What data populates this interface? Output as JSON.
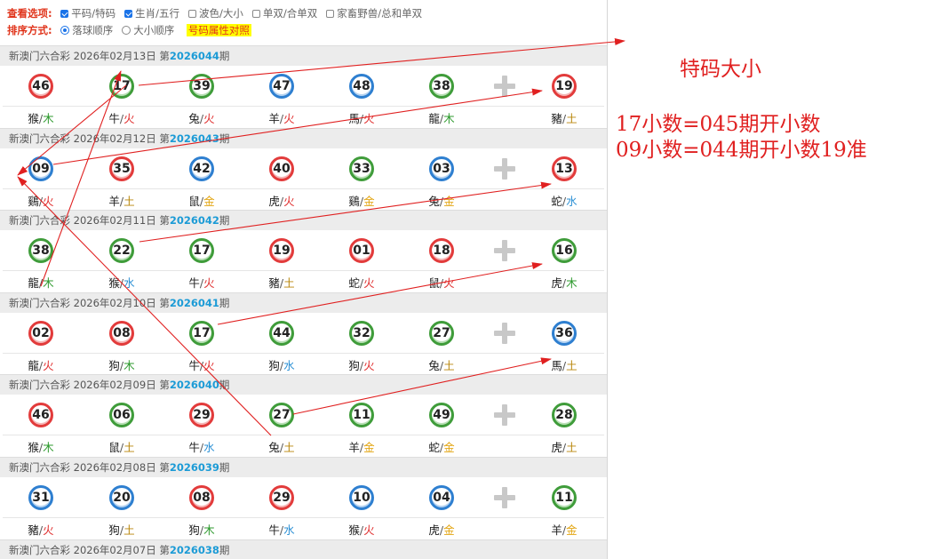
{
  "options": {
    "view_label": "查看选项:",
    "view_items": [
      {
        "label": "平码/特码",
        "checked": true
      },
      {
        "label": "生肖/五行",
        "checked": true
      },
      {
        "label": "波色/大小",
        "checked": false
      },
      {
        "label": "单双/合单双",
        "checked": false
      },
      {
        "label": "家畜野兽/总和单双",
        "checked": false
      }
    ],
    "sort_label": "排序方式:",
    "sort_items": [
      {
        "label": "落球顺序",
        "selected": true
      },
      {
        "label": "大小顺序",
        "selected": false
      }
    ],
    "highlight_link": "号码属性对照"
  },
  "draws": [
    {
      "lottery": "新澳门六合彩",
      "date": "2026年02月13日",
      "issue_prefix": "第",
      "issue": "2026044",
      "issue_suffix": "期",
      "balls": [
        {
          "num": "46",
          "color": "red",
          "zodiac": "猴",
          "element": "木"
        },
        {
          "num": "17",
          "color": "green",
          "zodiac": "牛",
          "element": "火"
        },
        {
          "num": "39",
          "color": "green",
          "zodiac": "兔",
          "element": "火"
        },
        {
          "num": "47",
          "color": "blue",
          "zodiac": "羊",
          "element": "火"
        },
        {
          "num": "48",
          "color": "blue",
          "zodiac": "馬",
          "element": "火"
        },
        {
          "num": "38",
          "color": "green",
          "zodiac": "龍",
          "element": "木"
        },
        {
          "num": "19",
          "color": "red",
          "zodiac": "豬",
          "element": "土"
        }
      ]
    },
    {
      "lottery": "新澳门六合彩",
      "date": "2026年02月12日",
      "issue_prefix": "第",
      "issue": "2026043",
      "issue_suffix": "期",
      "balls": [
        {
          "num": "09",
          "color": "blue",
          "zodiac": "鷄",
          "element": "火"
        },
        {
          "num": "35",
          "color": "red",
          "zodiac": "羊",
          "element": "土"
        },
        {
          "num": "42",
          "color": "blue",
          "zodiac": "鼠",
          "element": "金"
        },
        {
          "num": "40",
          "color": "red",
          "zodiac": "虎",
          "element": "火"
        },
        {
          "num": "33",
          "color": "green",
          "zodiac": "鷄",
          "element": "金"
        },
        {
          "num": "03",
          "color": "blue",
          "zodiac": "兔",
          "element": "金"
        },
        {
          "num": "13",
          "color": "red",
          "zodiac": "蛇",
          "element": "水"
        }
      ]
    },
    {
      "lottery": "新澳门六合彩",
      "date": "2026年02月11日",
      "issue_prefix": "第",
      "issue": "2026042",
      "issue_suffix": "期",
      "balls": [
        {
          "num": "38",
          "color": "green",
          "zodiac": "龍",
          "element": "木"
        },
        {
          "num": "22",
          "color": "green",
          "zodiac": "猴",
          "element": "水"
        },
        {
          "num": "17",
          "color": "green",
          "zodiac": "牛",
          "element": "火"
        },
        {
          "num": "19",
          "color": "red",
          "zodiac": "豬",
          "element": "土"
        },
        {
          "num": "01",
          "color": "red",
          "zodiac": "蛇",
          "element": "火"
        },
        {
          "num": "18",
          "color": "red",
          "zodiac": "鼠",
          "element": "火"
        },
        {
          "num": "16",
          "color": "green",
          "zodiac": "虎",
          "element": "木"
        }
      ]
    },
    {
      "lottery": "新澳门六合彩",
      "date": "2026年02月10日",
      "issue_prefix": "第",
      "issue": "2026041",
      "issue_suffix": "期",
      "balls": [
        {
          "num": "02",
          "color": "red",
          "zodiac": "龍",
          "element": "火"
        },
        {
          "num": "08",
          "color": "red",
          "zodiac": "狗",
          "element": "木"
        },
        {
          "num": "17",
          "color": "green",
          "zodiac": "牛",
          "element": "火"
        },
        {
          "num": "44",
          "color": "green",
          "zodiac": "狗",
          "element": "水"
        },
        {
          "num": "32",
          "color": "green",
          "zodiac": "狗",
          "element": "火"
        },
        {
          "num": "27",
          "color": "green",
          "zodiac": "兔",
          "element": "土"
        },
        {
          "num": "36",
          "color": "blue",
          "zodiac": "馬",
          "element": "土"
        }
      ]
    },
    {
      "lottery": "新澳门六合彩",
      "date": "2026年02月09日",
      "issue_prefix": "第",
      "issue": "2026040",
      "issue_suffix": "期",
      "balls": [
        {
          "num": "46",
          "color": "red",
          "zodiac": "猴",
          "element": "木"
        },
        {
          "num": "06",
          "color": "green",
          "zodiac": "鼠",
          "element": "土"
        },
        {
          "num": "29",
          "color": "red",
          "zodiac": "牛",
          "element": "水"
        },
        {
          "num": "27",
          "color": "green",
          "zodiac": "兔",
          "element": "土"
        },
        {
          "num": "11",
          "color": "green",
          "zodiac": "羊",
          "element": "金"
        },
        {
          "num": "49",
          "color": "green",
          "zodiac": "蛇",
          "element": "金"
        },
        {
          "num": "28",
          "color": "green",
          "zodiac": "虎",
          "element": "土"
        }
      ]
    },
    {
      "lottery": "新澳门六合彩",
      "date": "2026年02月08日",
      "issue_prefix": "第",
      "issue": "2026039",
      "issue_suffix": "期",
      "balls": [
        {
          "num": "31",
          "color": "blue",
          "zodiac": "豬",
          "element": "火"
        },
        {
          "num": "20",
          "color": "blue",
          "zodiac": "狗",
          "element": "土"
        },
        {
          "num": "08",
          "color": "red",
          "zodiac": "狗",
          "element": "木"
        },
        {
          "num": "29",
          "color": "red",
          "zodiac": "牛",
          "element": "水"
        },
        {
          "num": "10",
          "color": "blue",
          "zodiac": "猴",
          "element": "火"
        },
        {
          "num": "04",
          "color": "blue",
          "zodiac": "虎",
          "element": "金"
        },
        {
          "num": "11",
          "color": "green",
          "zodiac": "羊",
          "element": "金"
        }
      ]
    },
    {
      "lottery": "新澳门六合彩",
      "date": "2026年02月07日",
      "issue_prefix": "第",
      "issue": "2026038",
      "issue_suffix": "期",
      "balls": []
    }
  ],
  "annotations": {
    "title": "特码大小",
    "line1": "17小数=045期开小数",
    "line2": "09小数=044期开小数19准",
    "arrow_color": "#e02020"
  },
  "colors": {
    "ball_red": "#e23b3b",
    "ball_green": "#3f9c3a",
    "ball_blue": "#2e7fd0",
    "issue_blue": "#1c9bd6",
    "label_red": "#e0341b"
  }
}
